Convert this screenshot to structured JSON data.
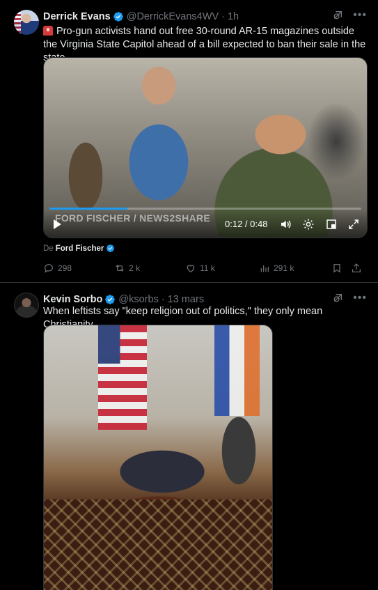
{
  "post1": {
    "name": "Derrick Evans",
    "handle": "@DerrickEvans4WV",
    "dot": "·",
    "time": "1h",
    "text": "Pro-gun activists hand out free 30-round AR-15 magazines outside the Virginia State Capitol ahead of a bill expected to ban their sale in the state.",
    "video": {
      "watermark": "FORD FISCHER / NEWS2SHARE",
      "timestamp": "0:12 / 0:48",
      "progress_percent": 25
    },
    "attribution_prefix": "De",
    "attribution_source": "Ford Fischer",
    "stats": {
      "replies": "298",
      "reposts": "2 k",
      "likes": "11 k",
      "views": "291 k"
    }
  },
  "post2": {
    "name": "Kevin Sorbo",
    "handle": "@ksorbs",
    "dot": "·",
    "time": "13 mars",
    "text": "When leftists say \"keep religion out of politics,\" they only mean Christianity"
  },
  "colors": {
    "accent": "#1d9bf0",
    "muted": "#71767b",
    "text": "#e7e9ea",
    "background": "#000000",
    "divider": "#2f3336"
  },
  "icons": [
    "verified-badge-icon",
    "grok-icon",
    "more-icon",
    "siren-emoji-icon",
    "play-icon",
    "volume-icon",
    "settings-icon",
    "pip-icon",
    "fullscreen-icon",
    "reply-icon",
    "repost-icon",
    "like-icon",
    "views-icon",
    "bookmark-icon",
    "share-icon"
  ]
}
